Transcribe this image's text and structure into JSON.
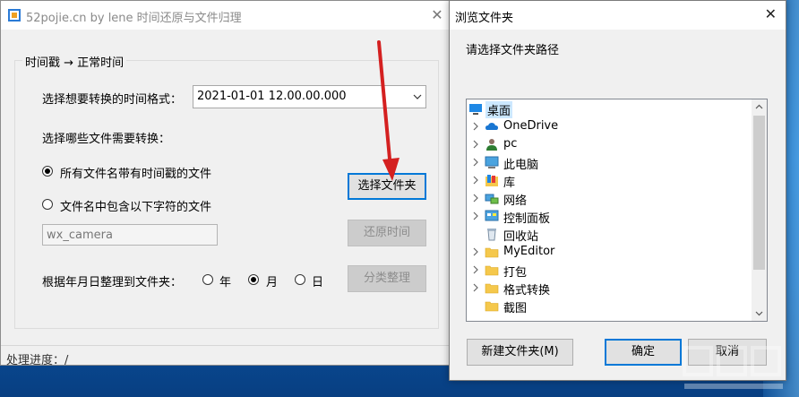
{
  "main_window": {
    "title": "52pojie.cn by lene 时间还原与文件归理",
    "group_title": "时间戳 → 正常时间",
    "format_label": "选择想要转换的时间格式：",
    "format_value": "2021-01-01 12.00.00.000",
    "which_files_label": "选择哪些文件需要转换：",
    "radio_all_files": "所有文件名带有时间戳的文件",
    "radio_contains": "文件名中包含以下字符的文件",
    "filter_input_value": "wx_camera",
    "select_folder_button": "选择文件夹",
    "restore_time_button": "还原时间",
    "organize_label": "根据年月日整理到文件夹：",
    "radio_year": "年",
    "radio_month": "月",
    "radio_day": "日",
    "classify_button": "分类整理",
    "status": "处理进度：/"
  },
  "dialog": {
    "title": "浏览文件夹",
    "prompt": "请选择文件夹路径",
    "tree_items": [
      {
        "label": "桌面",
        "icon": "desktop-icon",
        "selected": true,
        "expandable": false
      },
      {
        "label": "OneDrive",
        "icon": "cloud-icon",
        "selected": false,
        "expandable": true
      },
      {
        "label": "pc",
        "icon": "user-icon",
        "selected": false,
        "expandable": true
      },
      {
        "label": "此电脑",
        "icon": "computer-icon",
        "selected": false,
        "expandable": true
      },
      {
        "label": "库",
        "icon": "library-icon",
        "selected": false,
        "expandable": true
      },
      {
        "label": "网络",
        "icon": "network-icon",
        "selected": false,
        "expandable": true
      },
      {
        "label": "控制面板",
        "icon": "control-panel-icon",
        "selected": false,
        "expandable": true
      },
      {
        "label": "回收站",
        "icon": "recycle-bin-icon",
        "selected": false,
        "expandable": false
      },
      {
        "label": "MyEditor",
        "icon": "folder-icon",
        "selected": false,
        "expandable": true
      },
      {
        "label": "打包",
        "icon": "folder-icon",
        "selected": false,
        "expandable": true
      },
      {
        "label": "格式转换",
        "icon": "folder-icon",
        "selected": false,
        "expandable": true
      },
      {
        "label": "截图",
        "icon": "folder-icon",
        "selected": false,
        "expandable": false
      }
    ],
    "new_folder_button": "新建文件夹(M)",
    "ok_button": "确定",
    "cancel_button": "取消"
  },
  "colors": {
    "focus_blue": "#0078d7",
    "selection": "#cce8ff",
    "arrow_red": "#d42020",
    "folder_yellow": "#f5c84c"
  }
}
